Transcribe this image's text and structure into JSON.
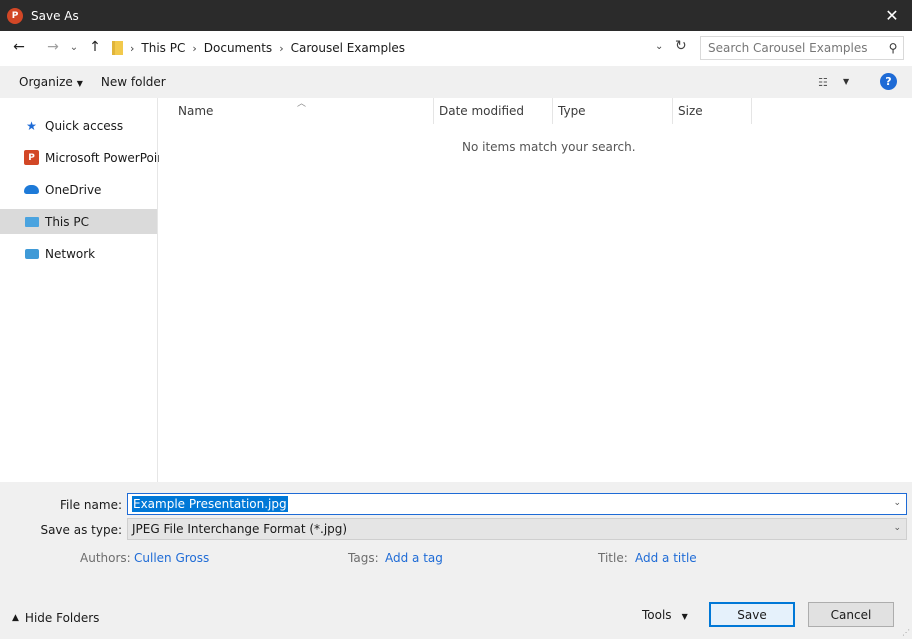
{
  "window": {
    "title": "Save As",
    "close_glyph": "✕",
    "app_icon_letter": "P"
  },
  "address": {
    "crumbs": [
      "This PC",
      "Documents",
      "Carousel Examples"
    ],
    "search_placeholder": "Search Carousel Examples"
  },
  "toolbar": {
    "organize": "Organize",
    "new_folder": "New folder",
    "help": "?"
  },
  "nav_pane": {
    "items": [
      {
        "label": "Quick access",
        "icon": "star-icon"
      },
      {
        "label": "Microsoft PowerPoint",
        "icon": "powerpoint-icon"
      },
      {
        "label": "OneDrive",
        "icon": "cloud-icon"
      },
      {
        "label": "This PC",
        "icon": "computer-icon",
        "selected": true
      },
      {
        "label": "Network",
        "icon": "network-icon"
      }
    ]
  },
  "file_list": {
    "columns": [
      "Name",
      "Date modified",
      "Type",
      "Size"
    ],
    "empty_message": "No items match your search."
  },
  "form": {
    "file_name_label": "File name:",
    "file_name_value": "Example Presentation.jpg",
    "save_type_label": "Save as type:",
    "save_type_value": "JPEG File Interchange Format (*.jpg)",
    "authors_label": "Authors:",
    "authors_value": "Cullen Gross",
    "tags_label": "Tags:",
    "tags_value": "Add a tag",
    "title_label": "Title:",
    "title_value": "Add a title"
  },
  "footer": {
    "hide_folders": "Hide Folders",
    "tools": "Tools",
    "save": "Save",
    "cancel": "Cancel"
  },
  "colors": {
    "accent": "#0078d7",
    "link": "#1e6bd6",
    "titlebar": "#2b2b2b",
    "ppt": "#d24726"
  }
}
